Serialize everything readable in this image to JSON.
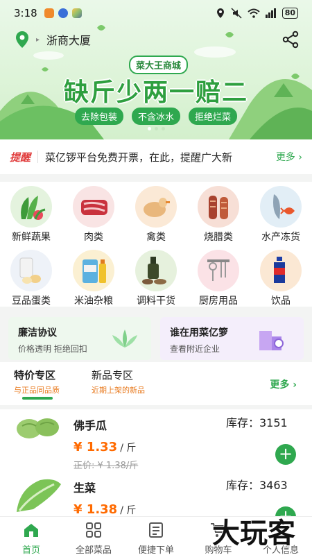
{
  "status": {
    "time": "3:18",
    "battery": "80"
  },
  "location": {
    "name": "浙商大厦"
  },
  "hero": {
    "brand": "菜大王商城",
    "title": "缺斤少两一赔二",
    "pills": [
      "去除包装",
      "不含冰水",
      "拒绝烂菜"
    ]
  },
  "notice": {
    "tag": "提醒",
    "text": "菜亿锣平台免费开票，在此，提醒广大新",
    "more": "更多"
  },
  "categories": [
    {
      "label": "新鲜蔬果",
      "icon": "vegetables-icon"
    },
    {
      "label": "肉类",
      "icon": "meat-icon"
    },
    {
      "label": "禽类",
      "icon": "poultry-icon"
    },
    {
      "label": "烧腊类",
      "icon": "roast-meat-icon"
    },
    {
      "label": "水产冻货",
      "icon": "seafood-icon"
    },
    {
      "label": "豆品蛋类",
      "icon": "eggs-icon"
    },
    {
      "label": "米油杂粮",
      "icon": "rice-oil-icon"
    },
    {
      "label": "调料干货",
      "icon": "seasoning-icon"
    },
    {
      "label": "厨房用品",
      "icon": "kitchenware-icon"
    },
    {
      "label": "饮品",
      "icon": "drinks-icon"
    }
  ],
  "promos": [
    {
      "title": "廉洁协议",
      "subtitle": "价格透明 拒绝回扣"
    },
    {
      "title": "谁在用菜亿箩",
      "subtitle": "查看附近企业"
    }
  ],
  "tabs": [
    {
      "title": "特价专区",
      "subtitle": "与正品同品质"
    },
    {
      "title": "新品专区",
      "subtitle": "近期上架的新品"
    }
  ],
  "tabs_more": "更多",
  "products": [
    {
      "name": "佛手瓜",
      "stock": "库存：3151",
      "price": "¥ 1.33",
      "unit": "/ 斤",
      "orig": "正价: ¥ 1.38/斤"
    },
    {
      "name": "生菜",
      "stock": "库存：3463",
      "price": "¥ 1.38",
      "unit": "/ 斤",
      "orig": ""
    }
  ],
  "nav": [
    {
      "label": "首页",
      "icon": "home-icon"
    },
    {
      "label": "全部菜品",
      "icon": "grid-icon"
    },
    {
      "label": "便捷下单",
      "icon": "order-icon"
    },
    {
      "label": "购物车",
      "icon": "cart-icon"
    },
    {
      "label": "个人信息",
      "icon": "profile-icon"
    }
  ],
  "watermark": "大玩客",
  "colors": {
    "brand": "#2fa84f",
    "price": "#ff6a00",
    "notice": "#e03b3b"
  }
}
